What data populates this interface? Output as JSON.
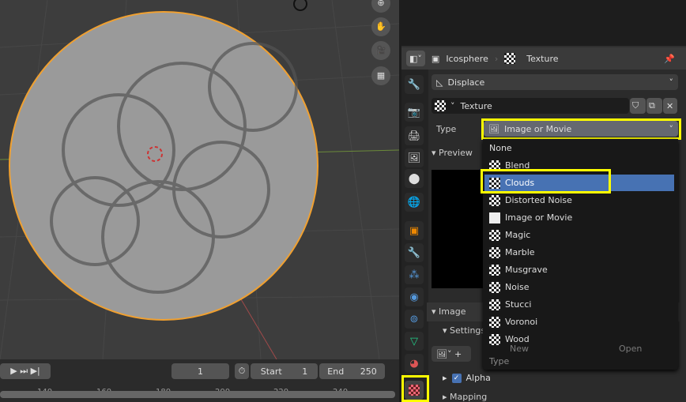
{
  "viewport": {
    "nav_icons": [
      "zoom-icon",
      "hand-icon",
      "camera-icon",
      "grid-icon"
    ]
  },
  "timeline": {
    "current_frame": "1",
    "start_label": "Start",
    "start_value": "1",
    "end_label": "End",
    "end_value": "250",
    "ticks": [
      "140",
      "160",
      "180",
      "200",
      "220",
      "240"
    ]
  },
  "header": {
    "object": "Icosphere",
    "texture_tab": "Texture"
  },
  "modifier": {
    "name": "Displace"
  },
  "texture": {
    "name": "Texture"
  },
  "type": {
    "label": "Type",
    "value": "Image or Movie"
  },
  "panels": {
    "preview": "Preview",
    "image": "Image",
    "settings": "Settings",
    "new": "New",
    "open": "Open",
    "alpha": "Alpha",
    "mapping": "Mapping"
  },
  "dropdown": {
    "items": [
      "None",
      "Blend",
      "Clouds",
      "Distorted Noise",
      "Image or Movie",
      "Magic",
      "Marble",
      "Musgrave",
      "Noise",
      "Stucci",
      "Voronoi",
      "Wood"
    ],
    "selected": "Clouds",
    "footer": "Type"
  },
  "colors": {
    "highlight": "#4772b3",
    "selection_outline": "#f0a030",
    "annotation": "#ffff00"
  }
}
